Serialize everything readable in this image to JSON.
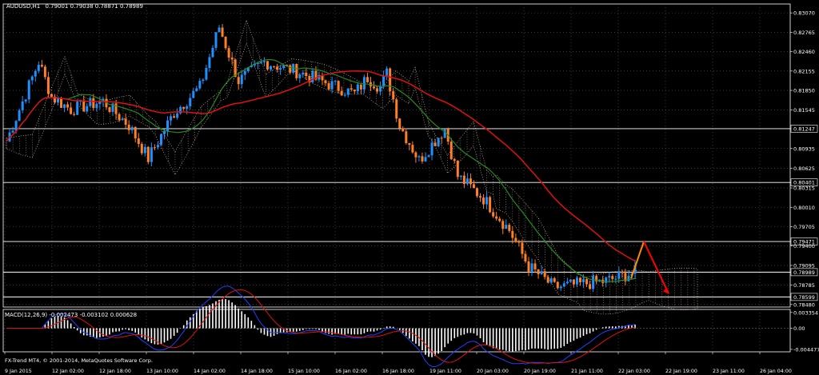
{
  "chart_data": [
    {
      "type": "candlestick",
      "symbol_label": "AUDUSD,H1",
      "ohlc_text": "0.79001 0.79038 0.78871 0.78989",
      "y_ticks": [
        "0.83070",
        "0.82765",
        "0.82460",
        "0.82155",
        "0.81850",
        "0.81545",
        "0.81247",
        "0.80935",
        "0.80625",
        "0.80401",
        "0.80315",
        "0.80010",
        "0.79705",
        "0.79471",
        "0.79400",
        "0.79095",
        "0.78989",
        "0.78785",
        "0.78599",
        "0.78480"
      ],
      "ylim": [
        0.7844,
        0.8321
      ],
      "x_ticks": [
        "9 Jan 2015",
        "12 Jan 02:00",
        "12 Jan 18:00",
        "13 Jan 10:00",
        "14 Jan 02:00",
        "14 Jan 18:00",
        "15 Jan 10:00",
        "16 Jan 02:00",
        "16 Jan 18:00",
        "19 Jan 11:00",
        "20 Jan 03:00",
        "20 Jan 19:00",
        "21 Jan 11:00",
        "22 Jan 03:00",
        "22 Jan 19:00",
        "23 Jan 11:00",
        "26 Jan 04:00"
      ],
      "horizontal_levels": [
        0.81247,
        0.80401,
        0.79471,
        0.78989,
        0.78599
      ],
      "grid": true,
      "colors": {
        "background": "#000000",
        "bull_candle": "#1e90ff",
        "bear_candle": "#ff7f27",
        "ma_fast": "#228b22",
        "ma_slow": "#e01010",
        "cloud": "#ffdab9",
        "level_line": "#ffffff",
        "forecast_up": "#ff8c00",
        "forecast_down": "#ff0000",
        "grid": "#606060"
      },
      "forecast": {
        "path": [
          0.7889,
          0.79471,
          0.7865
        ]
      }
    },
    {
      "type": "macd",
      "label": "MACD(12,26,9) -0.002473 -0.003102 0.000628",
      "y_ticks": [
        "0.003354",
        "0.00",
        "-0.004477"
      ],
      "ylim": [
        -0.005,
        0.004
      ],
      "colors": {
        "histogram": "#ffffff",
        "macd_line": "#1f3fff",
        "signal_line": "#e01010",
        "trend_segment": "#00ff00"
      }
    }
  ],
  "footer": {
    "copyright": "FX-Trend MT4, © 2001-2014, MetaQuotes Software Corp."
  }
}
